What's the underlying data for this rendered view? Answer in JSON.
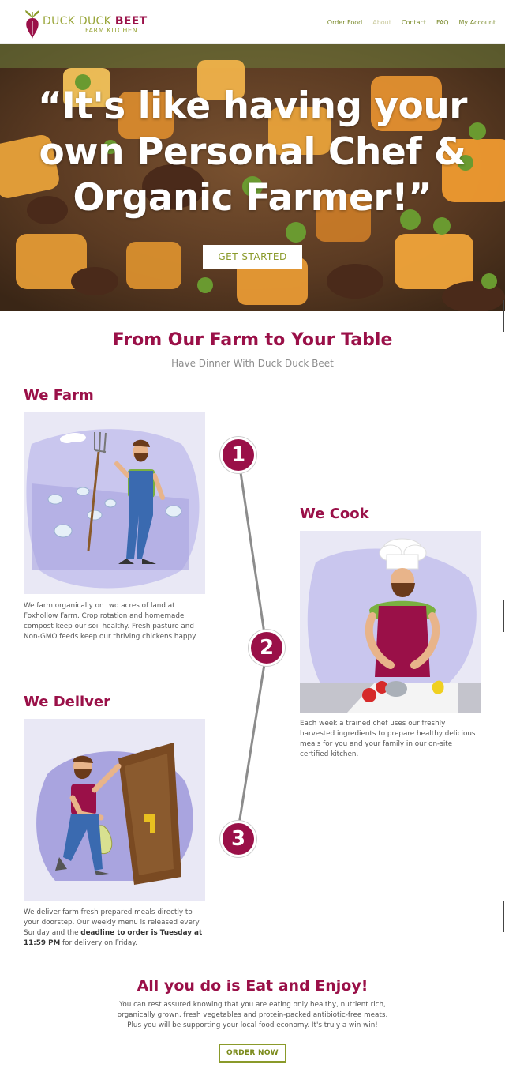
{
  "header": {
    "logo_line1_a": "DUCK DUCK ",
    "logo_line1_b": "BEET",
    "logo_line2": "FARM KITCHEN",
    "nav": [
      {
        "label": "Order Food"
      },
      {
        "label": "About"
      },
      {
        "label": "Contact"
      },
      {
        "label": "FAQ"
      },
      {
        "label": "My Account"
      }
    ]
  },
  "hero": {
    "quote": "“It's like having your own Personal Chef & Organic Farmer!”",
    "cta": "GET STARTED"
  },
  "intro": {
    "title": "From Our Farm to Your Table",
    "subtitle": "Have Dinner With Duck Duck Beet"
  },
  "steps": [
    {
      "number": "1",
      "title": "We Farm",
      "text": "We farm organically on two acres of land at Foxhollow Farm. Crop rotation and homemade compost keep our soil healthy. Fresh pasture and Non-GMO feeds keep our thriving chickens happy."
    },
    {
      "number": "2",
      "title": "We Cook",
      "text": "Each week a trained chef uses our freshly harvested ingredients to prepare healthy delicious meals for you and your family in our on-site certified kitchen."
    },
    {
      "number": "3",
      "title": "We Deliver",
      "text_a": "We deliver farm fresh prepared meals directly to your doorstep. Our weekly menu is released every Sunday and the ",
      "text_bold": "deadline to order is Tuesday at 11:59 PM",
      "text_b": " for delivery on Friday."
    }
  ],
  "enjoy": {
    "title": "All you do is Eat and Enjoy!",
    "text": "You can rest assured knowing that you are eating only healthy, nutrient rich, organically grown, fresh vegetables and protein-packed antibiotic-free meats. Plus you will be supporting your local food economy. It's truly a win win!",
    "cta": "ORDER NOW"
  },
  "colors": {
    "brand_beet": "#9a1048",
    "brand_green": "#8a9a2a"
  },
  "icons": {
    "logo": "beet-logo-icon"
  }
}
